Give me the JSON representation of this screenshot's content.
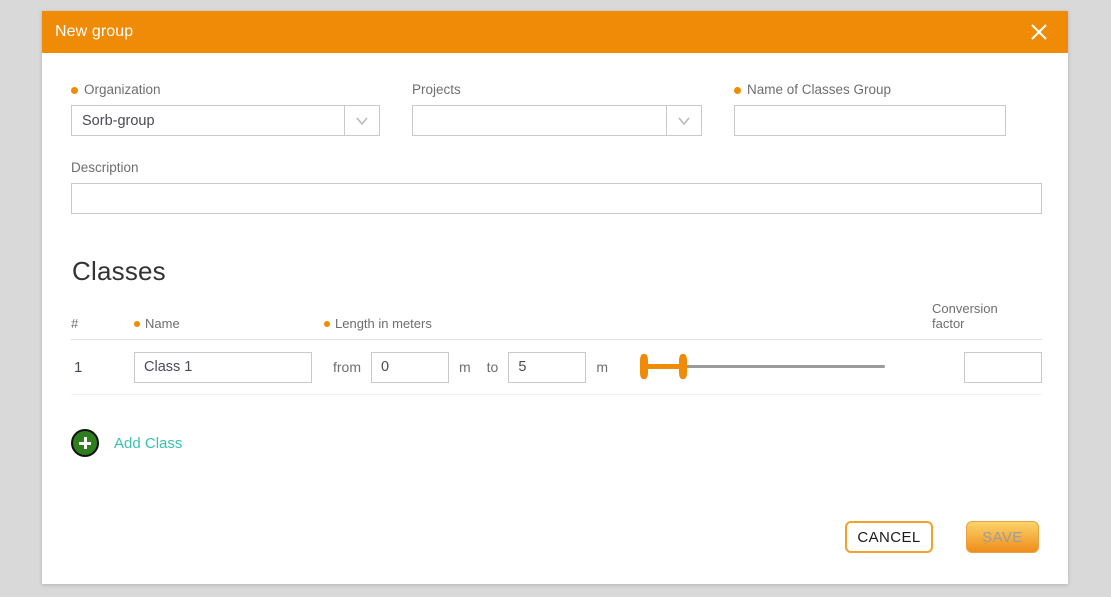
{
  "dialog": {
    "title": "New group",
    "close_icon": "close-icon"
  },
  "form": {
    "organization": {
      "label": "Organization",
      "required": true,
      "value": "Sorb-group",
      "arrow_icon": "chevron-down-icon"
    },
    "projects": {
      "label": "Projects",
      "required": false,
      "value": "",
      "placeholder": "",
      "arrow_icon": "chevron-down-icon"
    },
    "name_of_classes_group": {
      "label": "Name of Classes Group",
      "required": true,
      "value": "",
      "placeholder": ""
    },
    "description": {
      "label": "Description",
      "required": false,
      "value": "",
      "placeholder": ""
    }
  },
  "classes": {
    "heading": "Classes",
    "columns": {
      "number": "#",
      "name": "Name",
      "length": "Length in meters",
      "conversion_factor": "Conversion\nfactor",
      "conversion_factor_line1": "Conversion",
      "conversion_factor_line2": "factor"
    },
    "required_flags": {
      "name": true,
      "length": true
    },
    "rows": [
      {
        "number": "1",
        "name": "Class 1",
        "from_label": "from",
        "from_value": "0",
        "unit_from": "m",
        "to_label": "to",
        "to_value": "5",
        "unit_to": "m",
        "conversion_factor": "",
        "slider": {
          "min": 0,
          "max": 30,
          "low": 0,
          "high": 5
        }
      }
    ],
    "add_class": {
      "label": "Add Class",
      "icon": "plus-circle-icon"
    }
  },
  "footer": {
    "cancel_label": "CANCEL",
    "save_label": "SAVE"
  },
  "colors": {
    "accent": "#ef8b06",
    "page_background": "#d9d9d9",
    "add_class_text": "#3bbfb0",
    "add_class_circle": "#2e7d1e"
  }
}
